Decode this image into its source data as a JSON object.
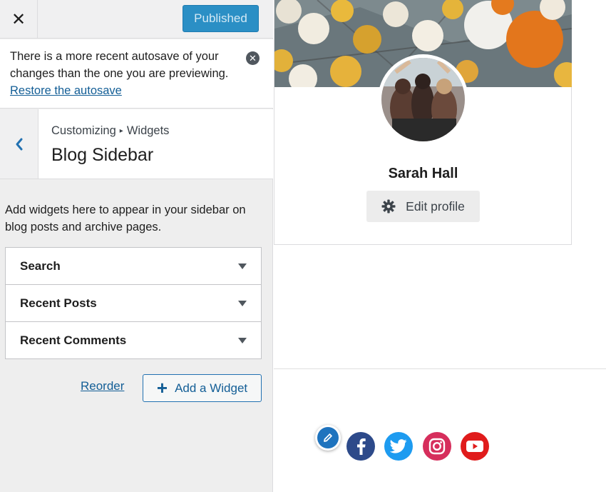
{
  "topbar": {
    "close_label": "✕",
    "publish_label": "Published"
  },
  "notice": {
    "text": "There is a more recent autosave of your changes than the one you are previewing.",
    "link": "Restore the autosave",
    "close_label": "✕"
  },
  "section": {
    "breadcrumb_parent": "Customizing",
    "breadcrumb_separator": "▸",
    "breadcrumb_child": "Widgets",
    "title": "Blog Sidebar",
    "description": "Add widgets here to appear in your sidebar on blog posts and archive pages."
  },
  "widgets": [
    {
      "title": "Search"
    },
    {
      "title": "Recent Posts"
    },
    {
      "title": "Recent Comments"
    }
  ],
  "actions": {
    "reorder_label": "Reorder",
    "add_widget_label": "Add a Widget",
    "add_widget_icon": "+"
  },
  "profile": {
    "name": "Sarah Hall",
    "edit_label": "Edit profile"
  },
  "social_icons": [
    "facebook-icon",
    "twitter-icon",
    "instagram-icon",
    "youtube-icon"
  ],
  "colors": {
    "accent": "#2271b1",
    "publish_button": "#2b8fc5",
    "facebook": "#2d4a8a",
    "twitter": "#1d9bf0",
    "instagram": "#d62e5c",
    "youtube": "#e01b1b"
  }
}
